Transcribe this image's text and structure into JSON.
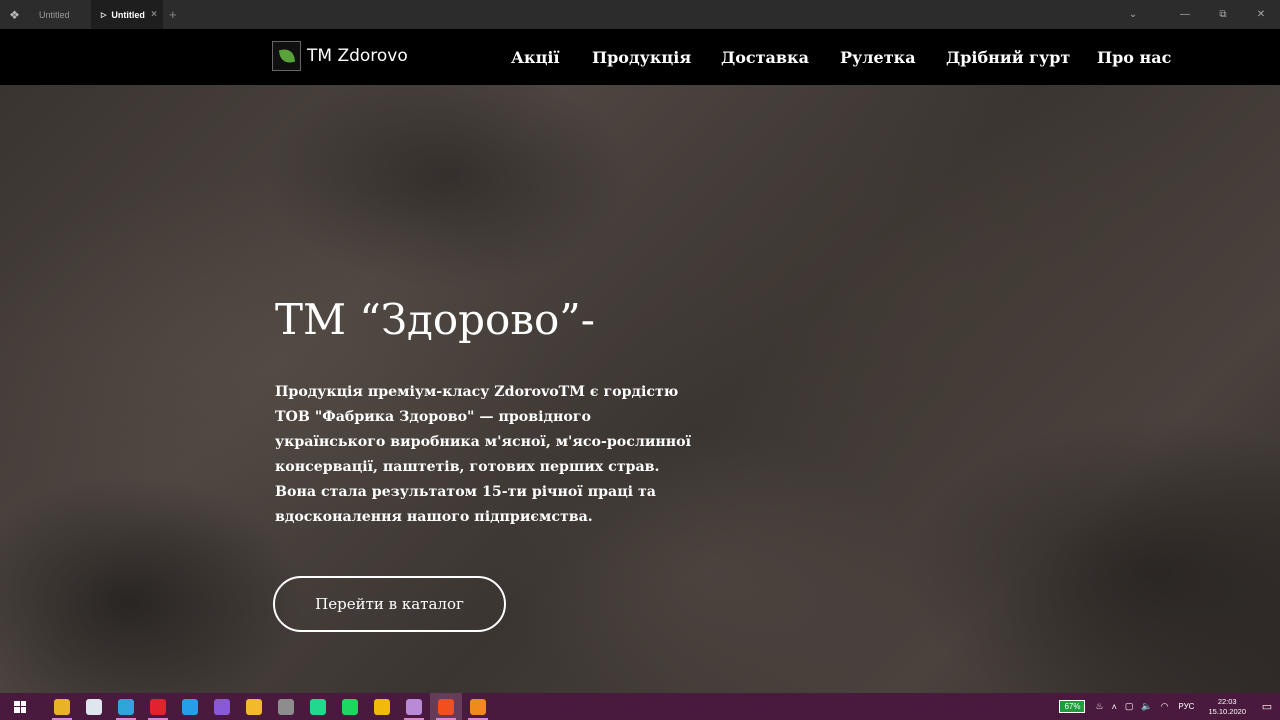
{
  "window": {
    "tabs": [
      {
        "label": "Untitled",
        "active": false
      },
      {
        "label": "Untitled",
        "active": true
      }
    ],
    "add_tab": "+",
    "controls": {
      "chevron": "⌄",
      "minimize": "—",
      "restore": "⧉",
      "close": "✕"
    }
  },
  "site": {
    "logo_text": "TM Zdorovo",
    "nav": [
      "Акції",
      "Продукція",
      "Доставка",
      "Рулетка",
      "Дрібний гурт",
      "Про нас"
    ]
  },
  "hero": {
    "title": "ТМ “Здорово”-",
    "text": "Продукція преміум-класу ZdorovoTM є гордістю ТОВ \"Фабрика Здорово\" — провідного українського виробника м'ясної, м'ясо-рослинної консервації, паштетів, готових перших страв. Вона стала результатом 15-ти річної праці та вдосконалення нашого підприємства.",
    "button": "Перейти в каталог"
  },
  "taskbar": {
    "apps": [
      {
        "name": "file-explorer-icon",
        "color": "#e8b325",
        "running": true
      },
      {
        "name": "notepad-icon",
        "color": "#dfe6ee",
        "running": false
      },
      {
        "name": "telegram-icon",
        "color": "#2ea6da",
        "running": true
      },
      {
        "name": "opera-icon",
        "color": "#e0232e",
        "running": true
      },
      {
        "name": "vscode-icon",
        "color": "#23a0e8",
        "running": false
      },
      {
        "name": "visual-studio-icon",
        "color": "#8a5ad6",
        "running": false
      },
      {
        "name": "chrome-icon",
        "color": "#f2b92b",
        "running": false
      },
      {
        "name": "calculator-icon",
        "color": "#8d8d8d",
        "running": false
      },
      {
        "name": "pycharm-icon",
        "color": "#22d88f",
        "running": false
      },
      {
        "name": "spotify-icon",
        "color": "#1ed760",
        "running": false
      },
      {
        "name": "binance-icon",
        "color": "#f0b90b",
        "running": false
      },
      {
        "name": "app-icon",
        "color": "#b98bd6",
        "running": true
      },
      {
        "name": "figma-icon",
        "color": "#f24e1e",
        "running": true,
        "active": true
      },
      {
        "name": "orange-app-icon",
        "color": "#f08a1c",
        "running": true
      }
    ],
    "battery": "67%",
    "language": "РУС",
    "time": "22:03",
    "date": "15.10.2020"
  }
}
